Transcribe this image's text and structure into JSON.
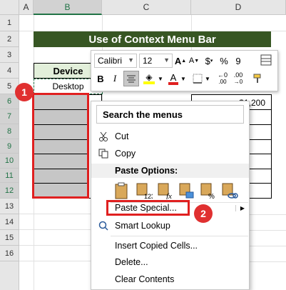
{
  "sheet": {
    "columns": [
      "A",
      "B",
      "C",
      "D"
    ],
    "rows": [
      "1",
      "2",
      "3",
      "4",
      "5",
      "6",
      "7",
      "8",
      "9",
      "10",
      "11",
      "12",
      "13",
      "14",
      "15",
      "16"
    ],
    "title": "Use of Context Menu Bar",
    "header_cell": "Device",
    "row5_cell": "Desktop",
    "row6_value": "$1,200"
  },
  "mini_toolbar": {
    "font_name": "Calibri",
    "font_size": "12",
    "bold": "B",
    "italic": "I",
    "currency": "$",
    "percent": "%",
    "comma": "9",
    "grow_font": "A",
    "shrink_font": "A",
    "font_color_letter": "A",
    "accent_color": "#e02020",
    "fill_color": "#ffff00"
  },
  "context_menu": {
    "search_label": "Search the menus",
    "cut": "Cut",
    "copy": "Copy",
    "paste_options": "Paste Options:",
    "paste_special": "Paste Special...",
    "smart_lookup": "Smart Lookup",
    "insert_copied": "Insert Copied Cells...",
    "delete": "Delete...",
    "clear_contents": "Clear Contents"
  },
  "annotations": {
    "badge1": "1",
    "badge2": "2"
  }
}
